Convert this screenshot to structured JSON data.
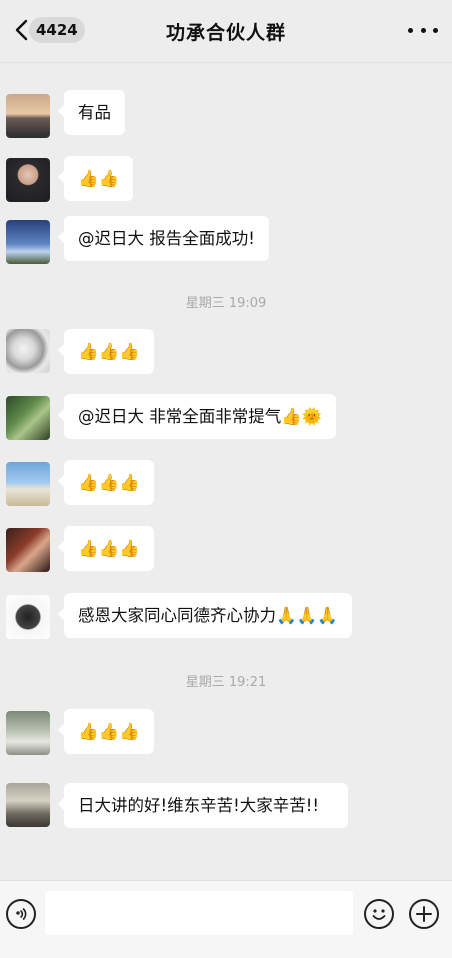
{
  "header": {
    "unread_count": "4424",
    "title": "功承合伙人群"
  },
  "messages": [
    {
      "text": "有品"
    },
    {
      "text": "👍👍"
    },
    {
      "text": "@迟日大 报告全面成功!"
    },
    {
      "text": "👍👍👍"
    },
    {
      "text": "@迟日大 非常全面非常提气👍🌞"
    },
    {
      "text": "👍👍👍"
    },
    {
      "text": "👍👍👍"
    },
    {
      "text": "感恩大家同心同德齐心协力🙏🙏🙏"
    },
    {
      "text": "👍👍👍"
    },
    {
      "text": "日大讲的好!维东辛苦!大家辛苦!!"
    }
  ],
  "timestamps": [
    "星期三 19:09",
    "星期三 19:21"
  ],
  "icons": {
    "back": "chevron-left-icon",
    "more": "more-dots-icon",
    "voice": "voice-icon",
    "emoji": "emoji-icon",
    "plus": "plus-icon"
  }
}
